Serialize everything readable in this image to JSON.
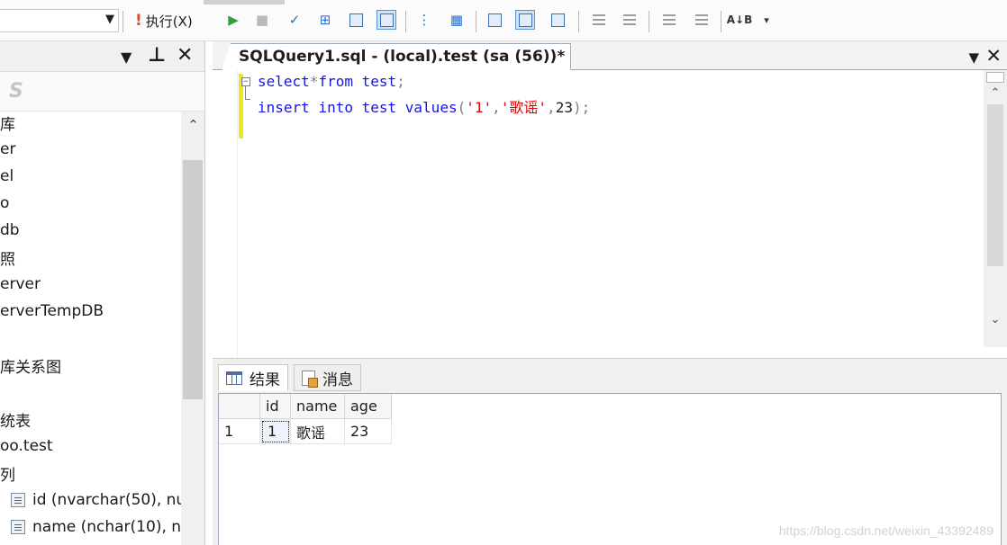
{
  "toolbar": {
    "execute_label": "执行(X)",
    "icons": [
      "execute-icon",
      "run-icon",
      "stop-icon",
      "parse-icon",
      "query-design-icon",
      "results-grid-icon",
      "results-text-icon",
      "comment-icon",
      "uncomment-icon",
      "outdent-icon",
      "indent-icon",
      "specify-values-icon"
    ]
  },
  "object_explorer": {
    "tree": [
      {
        "label": "库"
      },
      {
        "label": "er"
      },
      {
        "label": "el"
      },
      {
        "label": "o"
      },
      {
        "label": "db"
      },
      {
        "label": "照"
      },
      {
        "label": "erver"
      },
      {
        "label": "erverTempDB"
      },
      {
        "label": "库关系图"
      },
      {
        "label": "统表"
      },
      {
        "label": "oo.test"
      },
      {
        "label": "列"
      },
      {
        "label": "id (nvarchar(50), nu"
      },
      {
        "label": "name (nchar(10), n"
      }
    ]
  },
  "editor": {
    "tab_title": "SQLQuery1.sql - (local).test (sa (56))*",
    "code_lines": [
      [
        {
          "t": "select",
          "c": "kw"
        },
        {
          "t": "*",
          "c": "gray"
        },
        {
          "t": "from",
          "c": "kw"
        },
        {
          "t": " ",
          "c": "plain"
        },
        {
          "t": "test",
          "c": "kw"
        },
        {
          "t": ";",
          "c": "gray"
        }
      ],
      [
        {
          "t": "insert",
          "c": "kw"
        },
        {
          "t": " ",
          "c": "plain"
        },
        {
          "t": "into",
          "c": "kw"
        },
        {
          "t": " ",
          "c": "plain"
        },
        {
          "t": "test",
          "c": "kw"
        },
        {
          "t": " ",
          "c": "plain"
        },
        {
          "t": "values",
          "c": "kw"
        },
        {
          "t": "(",
          "c": "gray"
        },
        {
          "t": "'1'",
          "c": "str"
        },
        {
          "t": ",",
          "c": "gray"
        },
        {
          "t": "'歌谣'",
          "c": "str"
        },
        {
          "t": ",",
          "c": "gray"
        },
        {
          "t": "23",
          "c": "plain"
        },
        {
          "t": ");",
          "c": "gray"
        }
      ]
    ]
  },
  "results": {
    "tab_results": "结果",
    "tab_messages": "消息",
    "columns": [
      "id",
      "name",
      "age"
    ],
    "rows": [
      {
        "num": "1",
        "cells": [
          "1",
          "歌谣",
          "23"
        ]
      }
    ]
  },
  "watermark": "https://blog.csdn.net/weixin_43392489",
  "colors": {
    "keyword": "#1616e6",
    "string": "#e20000",
    "operator": "#808080",
    "change_bar": "#f2e71b"
  }
}
